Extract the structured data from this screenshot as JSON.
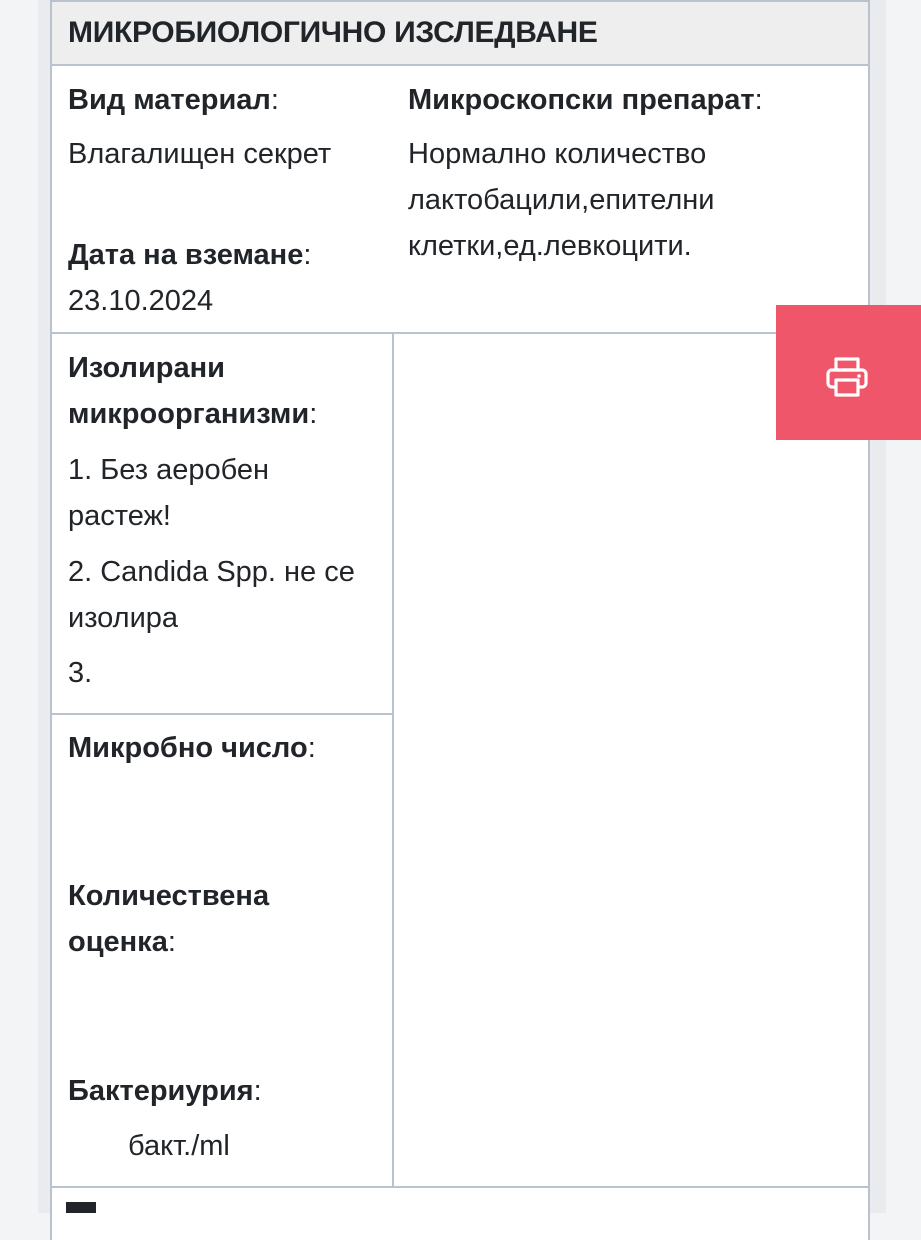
{
  "section": {
    "title": "МИКРОБИОЛОГИЧНО ИЗСЛЕДВАНЕ"
  },
  "material": {
    "label": "Вид материал",
    "value": "Влагалищен секрет"
  },
  "sample_date": {
    "label": "Дата на вземане",
    "value": "23.10.2024"
  },
  "microscopy": {
    "label": "Микроскопски препарат",
    "lines": [
      "Нормално количество",
      "лактобацили,епителни",
      "клетки,ед.левкоцити."
    ]
  },
  "isolated": {
    "label_lines": [
      "Изолирани",
      "микроорганизми"
    ],
    "items": [
      {
        "lines": [
          "1. Без аеробен",
          "растеж!"
        ]
      },
      {
        "lines": [
          "2. Candida Spp. не се",
          "изолира"
        ]
      },
      {
        "lines": [
          "3."
        ]
      }
    ]
  },
  "microbial_count": {
    "label": "Микробно число"
  },
  "quantitative": {
    "label_lines": [
      "Количествена",
      "оценка"
    ]
  },
  "bacteriuria": {
    "label": "Бактериурия",
    "unit": "бакт./ml"
  },
  "colon": ":",
  "print_icon": "printer-icon",
  "colors": {
    "accent": "#f0566a",
    "border": "#b9c2cf",
    "header_bg": "#eeeeee"
  }
}
